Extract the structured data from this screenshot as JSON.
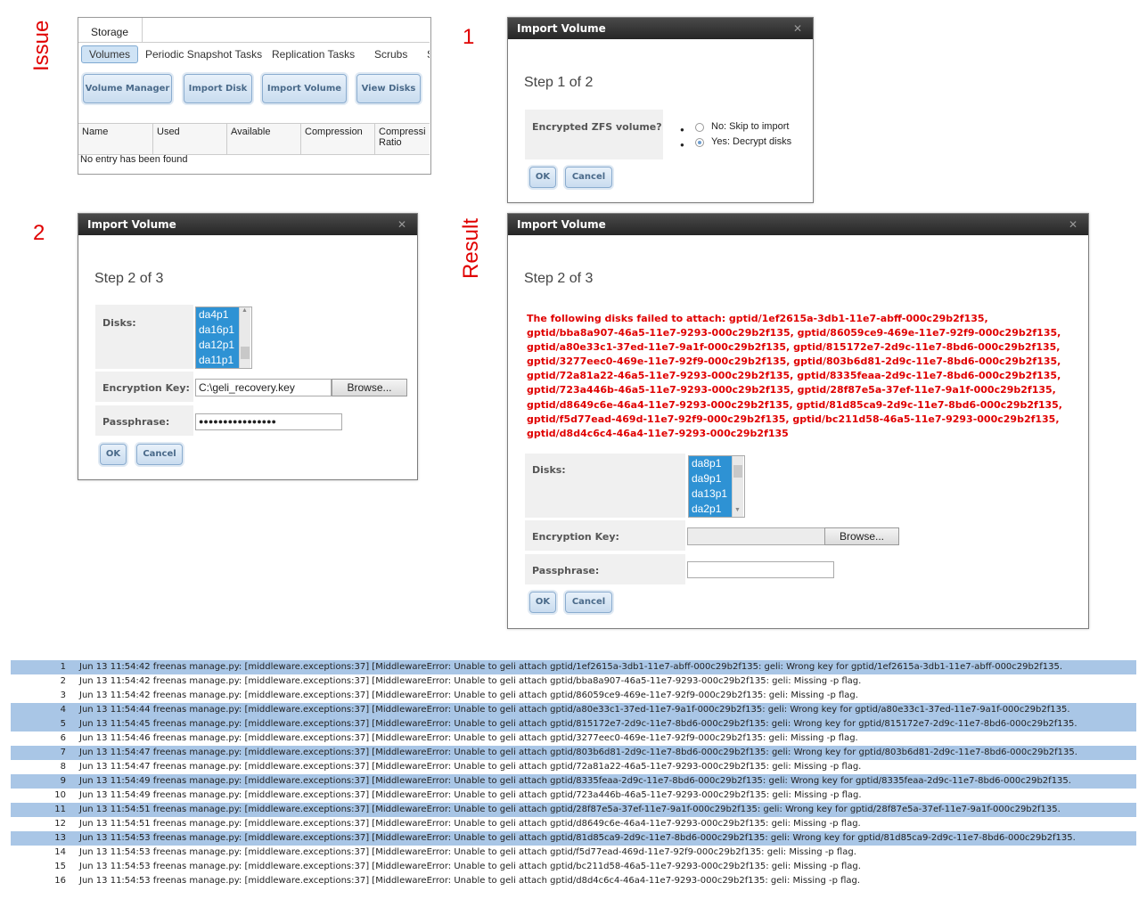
{
  "labels": {
    "issue": "Issue",
    "one": "1",
    "two": "2",
    "result": "Result"
  },
  "storage": {
    "tab": "Storage",
    "subtabs": [
      "Volumes",
      "Periodic Snapshot Tasks",
      "Replication Tasks",
      "Scrubs",
      "S"
    ],
    "buttons": [
      "Volume Manager",
      "Import Disk",
      "Import Volume",
      "View Disks"
    ],
    "columns": [
      "Name",
      "Used",
      "Available",
      "Compression",
      "Compressi Ratio"
    ],
    "empty_message": "No entry has been found"
  },
  "dialog1": {
    "title": "Import Volume",
    "step": "Step 1 of 2",
    "question": "Encrypted ZFS volume?",
    "options": [
      "No: Skip to import",
      "Yes: Decrypt disks"
    ],
    "selected_option": 1,
    "ok": "OK",
    "cancel": "Cancel"
  },
  "dialog2": {
    "title": "Import Volume",
    "step": "Step 2 of 3",
    "disks_label": "Disks:",
    "disks": [
      "da4p1",
      "da16p1",
      "da12p1",
      "da11p1"
    ],
    "enc_key_label": "Encryption Key:",
    "enc_key_value": "C:\\geli_recovery.key",
    "browse": "Browse...",
    "pass_label": "Passphrase:",
    "pass_value": "●●●●●●●●●●●●●●●●",
    "ok": "OK",
    "cancel": "Cancel"
  },
  "dialog3": {
    "title": "Import Volume",
    "step": "Step 2 of 3",
    "error_lines": [
      "The following disks failed to attach: gptid/1ef2615a-3db1-11e7-abff-000c29b2f135,",
      "gptid/bba8a907-46a5-11e7-9293-000c29b2f135, gptid/86059ce9-469e-11e7-92f9-000c29b2f135,",
      "gptid/a80e33c1-37ed-11e7-9a1f-000c29b2f135, gptid/815172e7-2d9c-11e7-8bd6-000c29b2f135,",
      "gptid/3277eec0-469e-11e7-92f9-000c29b2f135, gptid/803b6d81-2d9c-11e7-8bd6-000c29b2f135,",
      "gptid/72a81a22-46a5-11e7-9293-000c29b2f135, gptid/8335feaa-2d9c-11e7-8bd6-000c29b2f135,",
      "gptid/723a446b-46a5-11e7-9293-000c29b2f135, gptid/28f87e5a-37ef-11e7-9a1f-000c29b2f135,",
      "gptid/d8649c6e-46a4-11e7-9293-000c29b2f135, gptid/81d85ca9-2d9c-11e7-8bd6-000c29b2f135,",
      "gptid/f5d77ead-469d-11e7-92f9-000c29b2f135, gptid/bc211d58-46a5-11e7-9293-000c29b2f135,",
      "gptid/d8d4c6c4-46a4-11e7-9293-000c29b2f135"
    ],
    "disks_label": "Disks:",
    "disks": [
      "da8p1",
      "da9p1",
      "da13p1",
      "da2p1"
    ],
    "enc_key_label": "Encryption Key:",
    "browse": "Browse...",
    "pass_label": "Passphrase:",
    "ok": "OK",
    "cancel": "Cancel"
  },
  "log": [
    {
      "n": "1",
      "hl": true,
      "text": "Jun 13 11:54:42 freenas manage.py: [middleware.exceptions:37] [MiddlewareError: Unable to geli attach gptid/1ef2615a-3db1-11e7-abff-000c29b2f135: geli: Wrong key for gptid/1ef2615a-3db1-11e7-abff-000c29b2f135."
    },
    {
      "n": "2",
      "hl": false,
      "text": "Jun 13 11:54:42 freenas manage.py: [middleware.exceptions:37] [MiddlewareError: Unable to geli attach gptid/bba8a907-46a5-11e7-9293-000c29b2f135: geli: Missing -p flag."
    },
    {
      "n": "3",
      "hl": false,
      "text": "Jun 13 11:54:42 freenas manage.py: [middleware.exceptions:37] [MiddlewareError: Unable to geli attach gptid/86059ce9-469e-11e7-92f9-000c29b2f135: geli: Missing -p flag."
    },
    {
      "n": "4",
      "hl": true,
      "text": "Jun 13 11:54:44 freenas manage.py: [middleware.exceptions:37] [MiddlewareError: Unable to geli attach gptid/a80e33c1-37ed-11e7-9a1f-000c29b2f135: geli: Wrong key for gptid/a80e33c1-37ed-11e7-9a1f-000c29b2f135."
    },
    {
      "n": "5",
      "hl": true,
      "text": "Jun 13 11:54:45 freenas manage.py: [middleware.exceptions:37] [MiddlewareError: Unable to geli attach gptid/815172e7-2d9c-11e7-8bd6-000c29b2f135: geli: Wrong key for gptid/815172e7-2d9c-11e7-8bd6-000c29b2f135."
    },
    {
      "n": "6",
      "hl": false,
      "text": "Jun 13 11:54:46 freenas manage.py: [middleware.exceptions:37] [MiddlewareError: Unable to geli attach gptid/3277eec0-469e-11e7-92f9-000c29b2f135: geli: Missing -p flag."
    },
    {
      "n": "7",
      "hl": true,
      "text": "Jun 13 11:54:47 freenas manage.py: [middleware.exceptions:37] [MiddlewareError: Unable to geli attach gptid/803b6d81-2d9c-11e7-8bd6-000c29b2f135: geli: Wrong key for gptid/803b6d81-2d9c-11e7-8bd6-000c29b2f135."
    },
    {
      "n": "8",
      "hl": false,
      "text": "Jun 13 11:54:47 freenas manage.py: [middleware.exceptions:37] [MiddlewareError: Unable to geli attach gptid/72a81a22-46a5-11e7-9293-000c29b2f135: geli: Missing -p flag."
    },
    {
      "n": "9",
      "hl": true,
      "text": "Jun 13 11:54:49 freenas manage.py: [middleware.exceptions:37] [MiddlewareError: Unable to geli attach gptid/8335feaa-2d9c-11e7-8bd6-000c29b2f135: geli: Wrong key for gptid/8335feaa-2d9c-11e7-8bd6-000c29b2f135."
    },
    {
      "n": "10",
      "hl": false,
      "text": "Jun 13 11:54:49 freenas manage.py: [middleware.exceptions:37] [MiddlewareError: Unable to geli attach gptid/723a446b-46a5-11e7-9293-000c29b2f135: geli: Missing -p flag."
    },
    {
      "n": "11",
      "hl": true,
      "text": "Jun 13 11:54:51 freenas manage.py: [middleware.exceptions:37] [MiddlewareError: Unable to geli attach gptid/28f87e5a-37ef-11e7-9a1f-000c29b2f135: geli: Wrong key for gptid/28f87e5a-37ef-11e7-9a1f-000c29b2f135."
    },
    {
      "n": "12",
      "hl": false,
      "text": "Jun 13 11:54:51 freenas manage.py: [middleware.exceptions:37] [MiddlewareError: Unable to geli attach gptid/d8649c6e-46a4-11e7-9293-000c29b2f135: geli: Missing -p flag."
    },
    {
      "n": "13",
      "hl": true,
      "text": "Jun 13 11:54:53 freenas manage.py: [middleware.exceptions:37] [MiddlewareError: Unable to geli attach gptid/81d85ca9-2d9c-11e7-8bd6-000c29b2f135: geli: Wrong key for gptid/81d85ca9-2d9c-11e7-8bd6-000c29b2f135."
    },
    {
      "n": "14",
      "hl": false,
      "text": "Jun 13 11:54:53 freenas manage.py: [middleware.exceptions:37] [MiddlewareError: Unable to geli attach gptid/f5d77ead-469d-11e7-92f9-000c29b2f135: geli: Missing -p flag."
    },
    {
      "n": "15",
      "hl": false,
      "text": "Jun 13 11:54:53 freenas manage.py: [middleware.exceptions:37] [MiddlewareError: Unable to geli attach gptid/bc211d58-46a5-11e7-9293-000c29b2f135: geli: Missing -p flag."
    },
    {
      "n": "16",
      "hl": false,
      "text": "Jun 13 11:54:53 freenas manage.py: [middleware.exceptions:37] [MiddlewareError: Unable to geli attach gptid/d8d4c6c4-46a4-11e7-9293-000c29b2f135: geli: Missing -p flag."
    }
  ]
}
